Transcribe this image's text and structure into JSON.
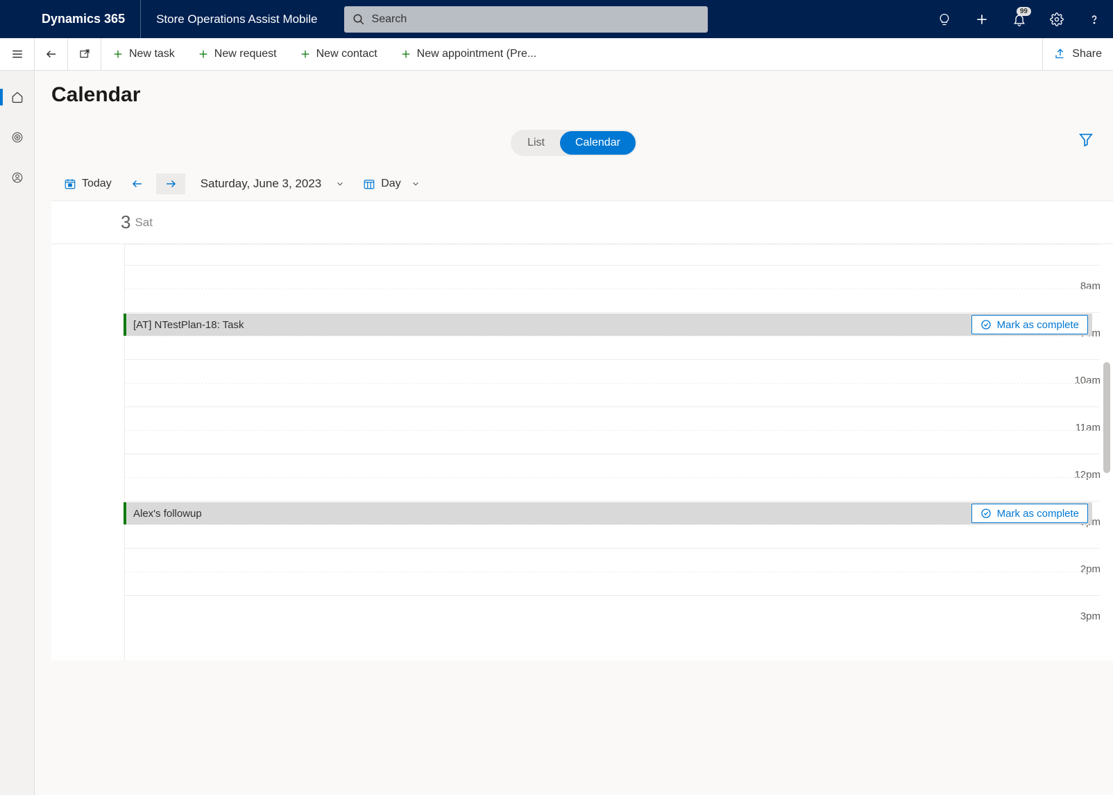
{
  "header": {
    "brand": "Dynamics 365",
    "app_name": "Store Operations Assist Mobile",
    "search_placeholder": "Search",
    "notification_badge": "99"
  },
  "commands": {
    "new_task": "New task",
    "new_request": "New request",
    "new_contact": "New contact",
    "new_appointment": "New appointment (Pre...",
    "share": "Share"
  },
  "page": {
    "title": "Calendar",
    "views": {
      "list": "List",
      "calendar": "Calendar"
    }
  },
  "calendar_toolbar": {
    "today": "Today",
    "date_label": "Saturday, June 3, 2023",
    "view_mode": "Day"
  },
  "day_header": {
    "day_num": "3",
    "dow": "Sat"
  },
  "time_labels": [
    "8am",
    "9am",
    "10am",
    "11am",
    "12pm",
    "1pm",
    "2pm",
    "3pm"
  ],
  "events": [
    {
      "title": "[AT] NTestPlan-18: Task",
      "complete_label": "Mark as complete"
    },
    {
      "title": "Alex's followup",
      "complete_label": "Mark as complete"
    }
  ]
}
